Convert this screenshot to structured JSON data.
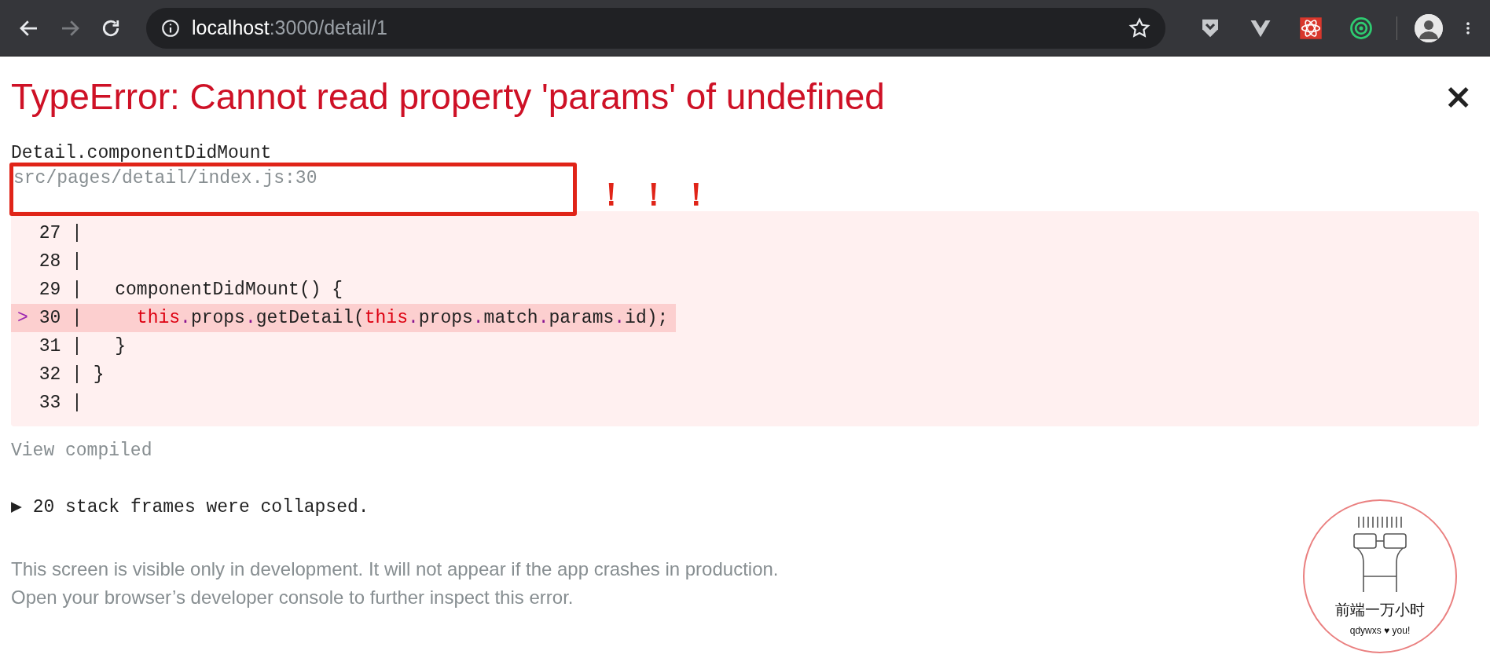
{
  "browser": {
    "url_host": "localhost",
    "url_path": ":3000/detail/1",
    "forward_disabled": true
  },
  "error": {
    "title": "TypeError: Cannot read property 'params' of undefined",
    "close": "×",
    "frame": "Detail.componentDidMount",
    "location": "src/pages/detail/index.js:30",
    "annotation": "！！！",
    "code_lines": [
      {
        "gutter": "27 |",
        "highlighted": false
      },
      {
        "gutter": "28 |",
        "highlighted": false
      },
      {
        "gutter": "29 |",
        "highlighted": false,
        "segments": [
          {
            "text": "   componentDidMount() {",
            "kind": "plain"
          }
        ]
      },
      {
        "gutter": "30 |     ",
        "pointer": ">",
        "highlighted": true,
        "segments": [
          {
            "text": "this",
            "kind": "keyword"
          },
          {
            "text": ".",
            "kind": "punct"
          },
          {
            "text": "props",
            "kind": "plain"
          },
          {
            "text": ".",
            "kind": "punct"
          },
          {
            "text": "getDetail(",
            "kind": "plain"
          },
          {
            "text": "this",
            "kind": "keyword"
          },
          {
            "text": ".",
            "kind": "punct"
          },
          {
            "text": "props",
            "kind": "plain"
          },
          {
            "text": ".",
            "kind": "punct"
          },
          {
            "text": "match",
            "kind": "plain"
          },
          {
            "text": ".",
            "kind": "punct"
          },
          {
            "text": "params",
            "kind": "plain"
          },
          {
            "text": ".",
            "kind": "punct"
          },
          {
            "text": "id);",
            "kind": "plain"
          }
        ]
      },
      {
        "gutter": "31 |",
        "highlighted": false,
        "segments": [
          {
            "text": "   }",
            "kind": "plain"
          }
        ]
      },
      {
        "gutter": "32 |",
        "highlighted": false,
        "segments": [
          {
            "text": " }",
            "kind": "plain"
          }
        ]
      },
      {
        "gutter": "33 |",
        "highlighted": false
      }
    ],
    "view_compiled": "View compiled",
    "collapsed_toggle": "▶",
    "collapsed": "20 stack frames were collapsed.",
    "footer": [
      "This screen is visible only in development. It will not appear if the app crashes in production.",
      "Open your browser’s developer console to further inspect this error."
    ]
  },
  "stamp": {
    "title": "前端一万小时",
    "subtitle": "qdywxs ♥ you!"
  }
}
